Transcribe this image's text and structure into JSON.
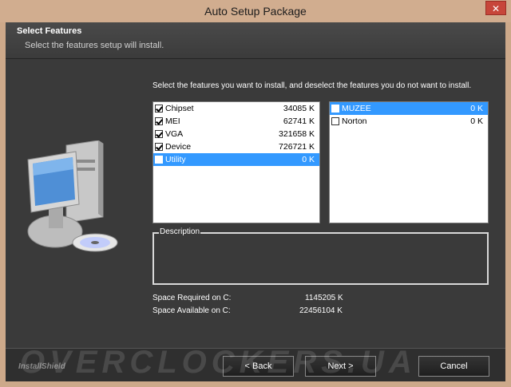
{
  "window": {
    "title": "Auto Setup Package",
    "close_glyph": "✕"
  },
  "header": {
    "title": "Select Features",
    "subtitle": "Select the features setup will install."
  },
  "instructions": "Select the features you want to install, and deselect the features you do not want to install.",
  "left_list": [
    {
      "name": "Chipset",
      "size": "34085 K",
      "checked": true,
      "selected": false
    },
    {
      "name": "MEI",
      "size": "62741 K",
      "checked": true,
      "selected": false
    },
    {
      "name": "VGA",
      "size": "321658 K",
      "checked": true,
      "selected": false
    },
    {
      "name": "Device",
      "size": "726721 K",
      "checked": true,
      "selected": false
    },
    {
      "name": "Utility",
      "size": "0 K",
      "checked": false,
      "selected": true
    }
  ],
  "right_list": [
    {
      "name": "MUZEE",
      "size": "0 K",
      "checked": false,
      "selected": true
    },
    {
      "name": "Norton",
      "size": "0 K",
      "checked": false,
      "selected": false
    }
  ],
  "description": {
    "label": "Description",
    "text": ""
  },
  "space": {
    "required_label": "Space Required on  C:",
    "required_value": "1145205 K",
    "available_label": "Space Available on  C:",
    "available_value": "22456104 K"
  },
  "footer": {
    "brand": "InstallShield",
    "watermark": "OVERCLOCKERS.UA",
    "back_label": "< Back",
    "next_label": "Next >",
    "cancel_label": "Cancel"
  }
}
